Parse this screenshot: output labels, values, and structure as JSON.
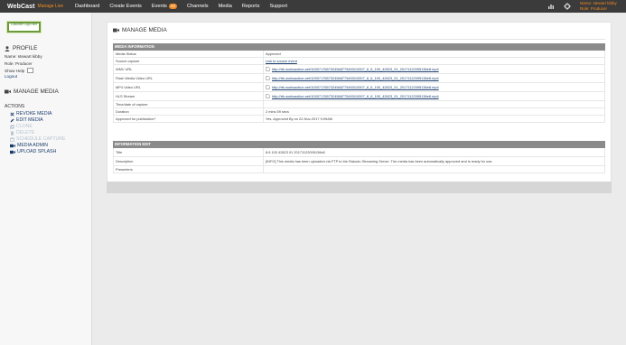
{
  "app": {
    "logo": "WebCast",
    "logo_sub": "Manage Live",
    "brand_color": "#f08a24"
  },
  "nav": [
    {
      "label": "Dashboard"
    },
    {
      "label": "Create Events"
    },
    {
      "label": "Events",
      "badge": "42"
    },
    {
      "label": "Channels"
    },
    {
      "label": "Media"
    },
    {
      "label": "Reports"
    },
    {
      "label": "Support"
    }
  ],
  "user": {
    "name_line": "Name: stewart kibby",
    "role_line": "Role: Producer"
  },
  "sidebar": {
    "logo_text": "Customer Logo Here",
    "profile_heading": "PROFILE",
    "name": "Name: stewart kibby",
    "role": "Role: Producer",
    "show_help": "Show Help",
    "logout": "Logout",
    "manage_heading": "MANAGE MEDIA",
    "actions_heading": "ACTIONS",
    "actions": [
      {
        "label": "REVOKE MEDIA",
        "icon": "x-icon",
        "enabled": true
      },
      {
        "label": "EDIT MEDIA",
        "icon": "pencil-icon",
        "enabled": true
      },
      {
        "label": "CLONE",
        "icon": "clone-icon",
        "enabled": false
      },
      {
        "label": "DELETE",
        "icon": "trash-icon",
        "enabled": false
      },
      {
        "label": "SCHEDULE CAPTURE",
        "icon": "calendar-icon",
        "enabled": false
      },
      {
        "label": "MEDIA ADMIN",
        "icon": "video-camera-icon",
        "enabled": true
      },
      {
        "label": "UPLOAD SPLASH",
        "icon": "video-camera-icon",
        "enabled": true
      }
    ]
  },
  "main": {
    "title": "MANAGE MEDIA",
    "media_info": {
      "heading": "MEDIA INFORMATION",
      "rows": [
        {
          "key": "Media Status",
          "value": "Approved"
        },
        {
          "key": "Source capture",
          "value": "Link to source event"
        },
        {
          "key": "WMV URL",
          "value": "http://rtk.worksaction.net/1000717657324568775493/10007_8_6_100_42823_01_20171122095136e8.mp4"
        },
        {
          "key": "Flash Media Video URL",
          "value": "http://rtk.worksaction.net/1000717657324568775493/10007_8_6_100_42823_01_20171122095136e8.mp4"
        },
        {
          "key": "MP4 Video URL",
          "value": "http://rtk.worksaction.net/1000717657324568775493/10007_8_6_100_42823_01_20171122095136e8.mp4"
        },
        {
          "key": "HLS Stream",
          "value": "http://rtk.worksaction.net/1000717657324568775493/10007_8_6_100_42823_01_20171122095136e8.mp4"
        },
        {
          "key": "Time/date of capture",
          "value": ""
        },
        {
          "key": "Duration",
          "value": "2 mins 59 secs"
        },
        {
          "key": "Approved for publication?",
          "value": "Yes, Approved By on 22-Nov-2017 9:09AM"
        }
      ]
    },
    "info_edit": {
      "heading": "INFORMATION EDIT",
      "rows": [
        {
          "key": "Title",
          "value": "8.6 100 42823 01 20171122095136e8"
        },
        {
          "key": "Description",
          "value": "[INFO] This media has been uploaded via FTP to the Rakudo Streaming Server. The media has been automatically approved and is ready for use."
        },
        {
          "key": "Presenters",
          "value": ""
        }
      ]
    }
  }
}
